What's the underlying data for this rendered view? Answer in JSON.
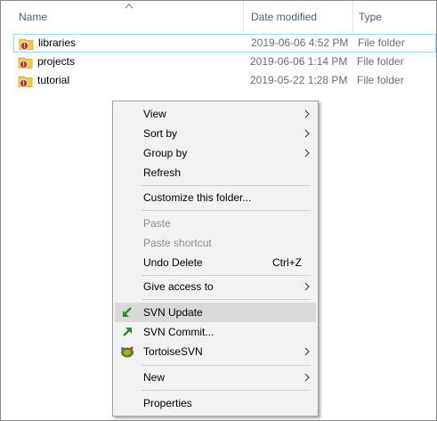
{
  "columns": {
    "name": "Name",
    "date_modified": "Date modified",
    "type": "Type"
  },
  "files": [
    {
      "name": "libraries",
      "date": "2019-06-06 4:52 PM",
      "type": "File folder"
    },
    {
      "name": "projects",
      "date": "2019-06-06 1:14 PM",
      "type": "File folder"
    },
    {
      "name": "tutorial",
      "date": "2019-05-22 1:28 PM",
      "type": "File folder"
    }
  ],
  "menu": {
    "view": "View",
    "sort_by": "Sort by",
    "group_by": "Group by",
    "refresh": "Refresh",
    "customize": "Customize this folder...",
    "paste": "Paste",
    "paste_shortcut": "Paste shortcut",
    "undo_delete": "Undo Delete",
    "undo_delete_shortcut": "Ctrl+Z",
    "give_access": "Give access to",
    "svn_update": "SVN Update",
    "svn_commit": "SVN Commit...",
    "tortoisesvn": "TortoiseSVN",
    "new": "New",
    "properties": "Properties"
  },
  "icons": {
    "folder": "folder-icon",
    "svn_conflict_overlay": "svn-conflict-overlay-icon",
    "svn_update": "svn-update-icon",
    "svn_commit": "svn-commit-icon",
    "tortoisesvn": "tortoisesvn-icon",
    "submenu": "chevron-right-icon",
    "sort": "sort-ascending-icon"
  },
  "colors": {
    "header_text": "#4c607a",
    "folder_yellow": "#f2c94c",
    "conflict_red": "#c0392b",
    "menu_bg": "#f2f2f2",
    "menu_hover": "#d9d9d9",
    "selection_border": "#99d1ff",
    "svn_green": "#2e8b2e"
  }
}
